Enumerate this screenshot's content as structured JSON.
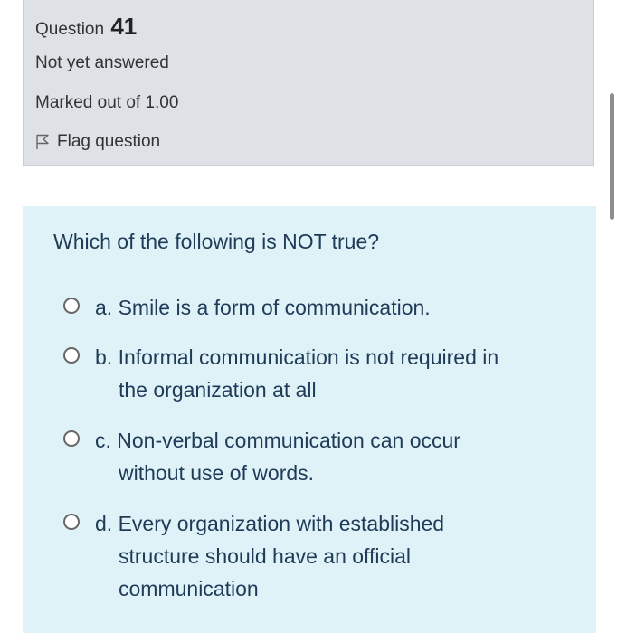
{
  "info": {
    "question_label": "Question",
    "question_number": "41",
    "status": "Not yet answered",
    "marks": "Marked out of 1.00",
    "flag_label": "Flag question"
  },
  "question": {
    "text": "Which of the following is NOT true?",
    "options": [
      {
        "lines": [
          "a. Smile is a form of communication."
        ]
      },
      {
        "lines": [
          "b. Informal communication is not required in",
          "the organization at all"
        ]
      },
      {
        "lines": [
          "c. Non-verbal communication can occur",
          "without use of words."
        ]
      },
      {
        "lines": [
          "d. Every organization with established",
          "structure should have an official",
          "communication"
        ]
      }
    ]
  },
  "icons": {
    "flag": "flag-icon",
    "radio": "radio-button-icon"
  }
}
